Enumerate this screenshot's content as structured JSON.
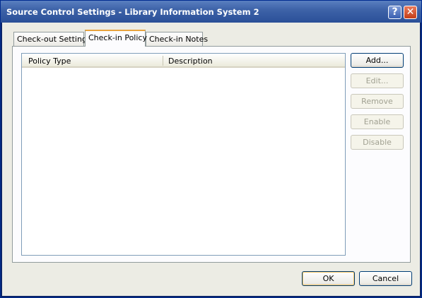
{
  "window": {
    "title": "Source Control Settings - Library Information System 2",
    "help_glyph": "?",
    "close_glyph": "✕"
  },
  "tabs": [
    {
      "label": "Check-out Settings",
      "active": false
    },
    {
      "label": "Check-in Policy",
      "active": true
    },
    {
      "label": "Check-in Notes",
      "active": false
    }
  ],
  "policy_list": {
    "columns": [
      "Policy Type",
      "Description"
    ],
    "rows": []
  },
  "side_buttons": {
    "add": "Add...",
    "edit": "Edit...",
    "remove": "Remove",
    "enable": "Enable",
    "disable": "Disable"
  },
  "footer": {
    "ok": "OK",
    "cancel": "Cancel"
  }
}
